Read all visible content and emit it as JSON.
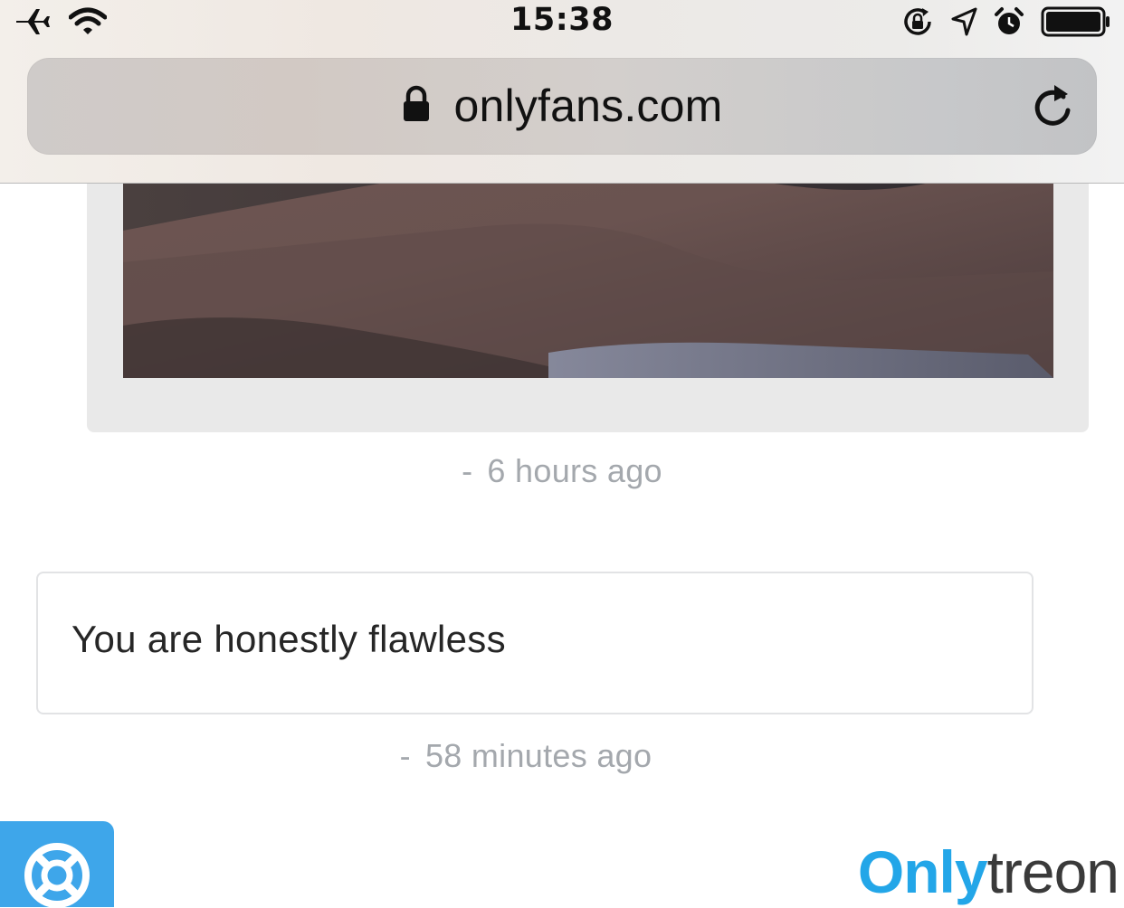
{
  "status_bar": {
    "time": "15:38",
    "icons": [
      "airplane-icon",
      "wifi-icon",
      "orientation-lock-icon",
      "location-icon",
      "alarm-icon",
      "battery-icon"
    ]
  },
  "address_bar": {
    "url": "onlyfans.com",
    "secure_icon": "lock-icon",
    "reload_icon": "reload-icon"
  },
  "feed": {
    "post": {
      "media_type": "photo",
      "timestamp_dash": "-",
      "timestamp": "6 hours ago"
    },
    "message": {
      "text": "You are honestly flawless",
      "timestamp_dash": "-",
      "timestamp": "58 minutes ago"
    }
  },
  "support_button": {
    "icon": "lifebuoy-icon"
  },
  "watermark": {
    "part1": "Only",
    "part2": "treon"
  },
  "colors": {
    "support_blue": "#3ea6ea",
    "watermark_blue": "#23a6e8",
    "timestamp_gray": "#a4a8ad",
    "card_gray": "#e9e9e9"
  }
}
